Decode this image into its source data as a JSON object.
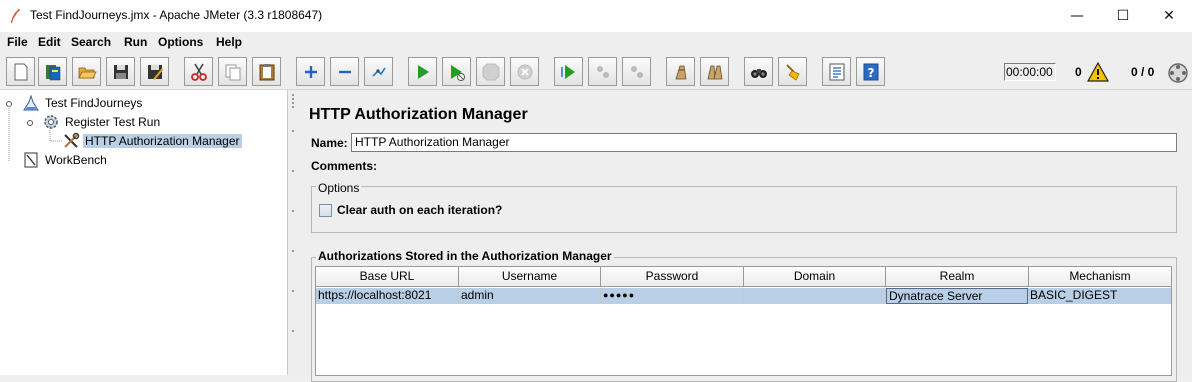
{
  "window": {
    "title": "Test FindJourneys.jmx - Apache JMeter (3.3 r1808647)",
    "minimize_glyph": "—",
    "maximize_glyph": "☐",
    "close_glyph": "✕"
  },
  "menu": [
    "File",
    "Edit",
    "Search",
    "Run",
    "Options",
    "Help"
  ],
  "toolbar": {
    "buttons": [
      "new-icon",
      "templates-icon",
      "open-icon",
      "save-icon",
      "save-as-icon",
      "cut-icon",
      "copy-icon",
      "paste-icon",
      "expand-icon",
      "collapse-icon",
      "toggle-icon",
      "start-icon",
      "start-no-pause-icon",
      "stop-icon",
      "shutdown-icon",
      "remote-start-icon",
      "remote-stop-icon",
      "remote-shutdown-icon",
      "clear-icon",
      "clear-all-icon",
      "search-icon",
      "reset-search-icon",
      "function-helper-icon",
      "help-icon"
    ],
    "timer": "00:00:00",
    "error_count": "0",
    "threads": "0 / 0"
  },
  "tree": {
    "items": [
      {
        "label": "Test FindJourneys",
        "icon": "test-plan-icon"
      },
      {
        "label": "Register Test Run",
        "icon": "gear-icon"
      },
      {
        "label": "HTTP Authorization Manager",
        "icon": "tools-icon",
        "selected": true
      },
      {
        "label": "WorkBench",
        "icon": "workbench-icon"
      }
    ]
  },
  "panel": {
    "title": "HTTP Authorization Manager",
    "name_label": "Name:",
    "name_value": "HTTP Authorization Manager",
    "comments_label": "Comments:",
    "options_title": "Options",
    "clear_auth_label": "Clear auth on each iteration?",
    "clear_auth_checked": false,
    "auth_title": "Authorizations Stored in the Authorization Manager",
    "columns": [
      "Base URL",
      "Username",
      "Password",
      "Domain",
      "Realm",
      "Mechanism"
    ],
    "rows": [
      [
        "https://localhost:8021",
        "admin",
        "●●●●●",
        "",
        "Dynatrace Server",
        "BASIC_DIGEST"
      ]
    ]
  },
  "colors": {
    "selection": "#b8cfe5",
    "background": "#eeeeee",
    "start_green": "#1fa01f",
    "warning_yellow": "#f3c300"
  }
}
